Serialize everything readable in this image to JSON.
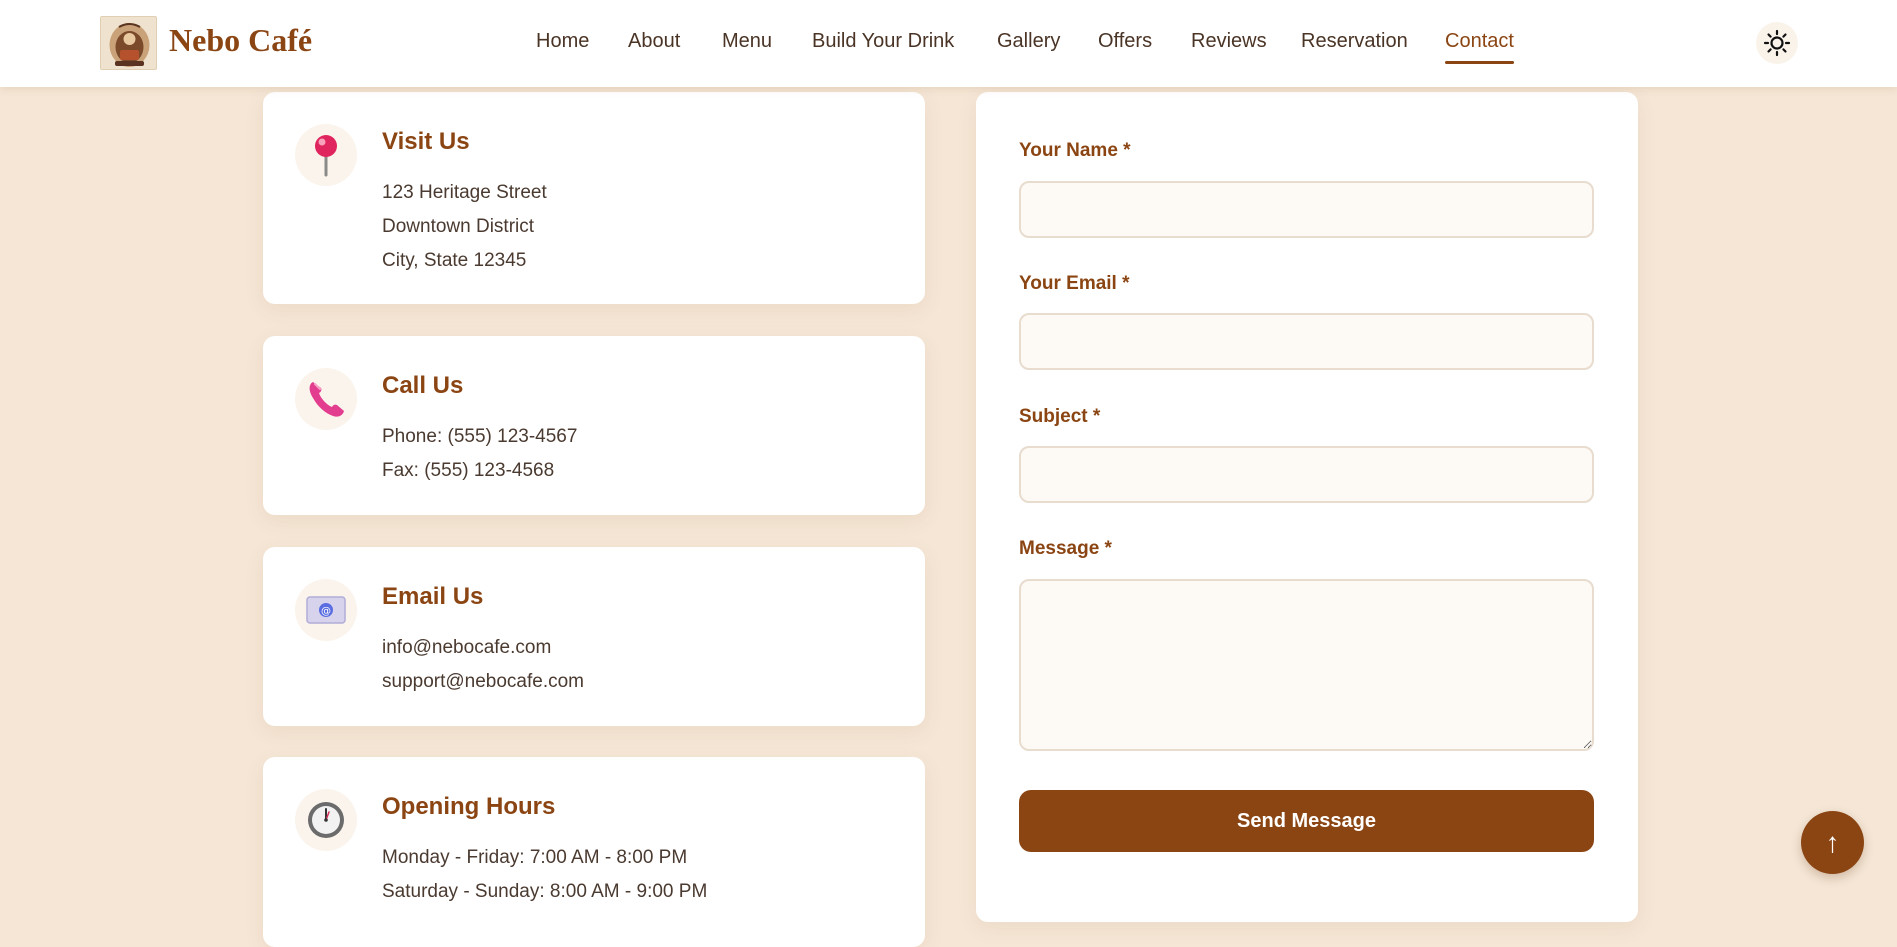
{
  "header": {
    "brand": "Nebo Café",
    "nav": [
      {
        "label": "Home"
      },
      {
        "label": "About"
      },
      {
        "label": "Menu"
      },
      {
        "label": "Build Your Drink"
      },
      {
        "label": "Gallery"
      },
      {
        "label": "Offers"
      },
      {
        "label": "Reviews"
      },
      {
        "label": "Reservation"
      },
      {
        "label": "Contact"
      }
    ],
    "active_nav": "Contact",
    "theme_icon": "sun-icon"
  },
  "cards": [
    {
      "icon": "pin-icon",
      "title": "Visit Us",
      "lines": [
        "123 Heritage Street",
        "Downtown District",
        "City, State 12345"
      ]
    },
    {
      "icon": "phone-icon",
      "title": "Call Us",
      "lines": [
        "Phone: (555) 123-4567",
        "Fax: (555) 123-4568"
      ]
    },
    {
      "icon": "email-icon",
      "title": "Email Us",
      "lines": [
        "info@nebocafe.com",
        "support@nebocafe.com"
      ]
    },
    {
      "icon": "clock-icon",
      "title": "Opening Hours",
      "lines": [
        "Monday - Friday: 7:00 AM - 8:00 PM",
        "Saturday - Sunday: 8:00 AM - 9:00 PM"
      ]
    }
  ],
  "form": {
    "name_label": "Your Name *",
    "email_label": "Your Email *",
    "subject_label": "Subject *",
    "message_label": "Message *",
    "name_value": "",
    "email_value": "",
    "subject_value": "",
    "message_value": "",
    "submit_label": "Send Message"
  },
  "scroll_top": {
    "label": "↑",
    "icon": "arrow-up-icon"
  },
  "colors": {
    "accent": "#8b4513",
    "page_bg": "#f5e6d6",
    "card_bg": "#ffffff",
    "input_bg": "#fdf9f4"
  }
}
